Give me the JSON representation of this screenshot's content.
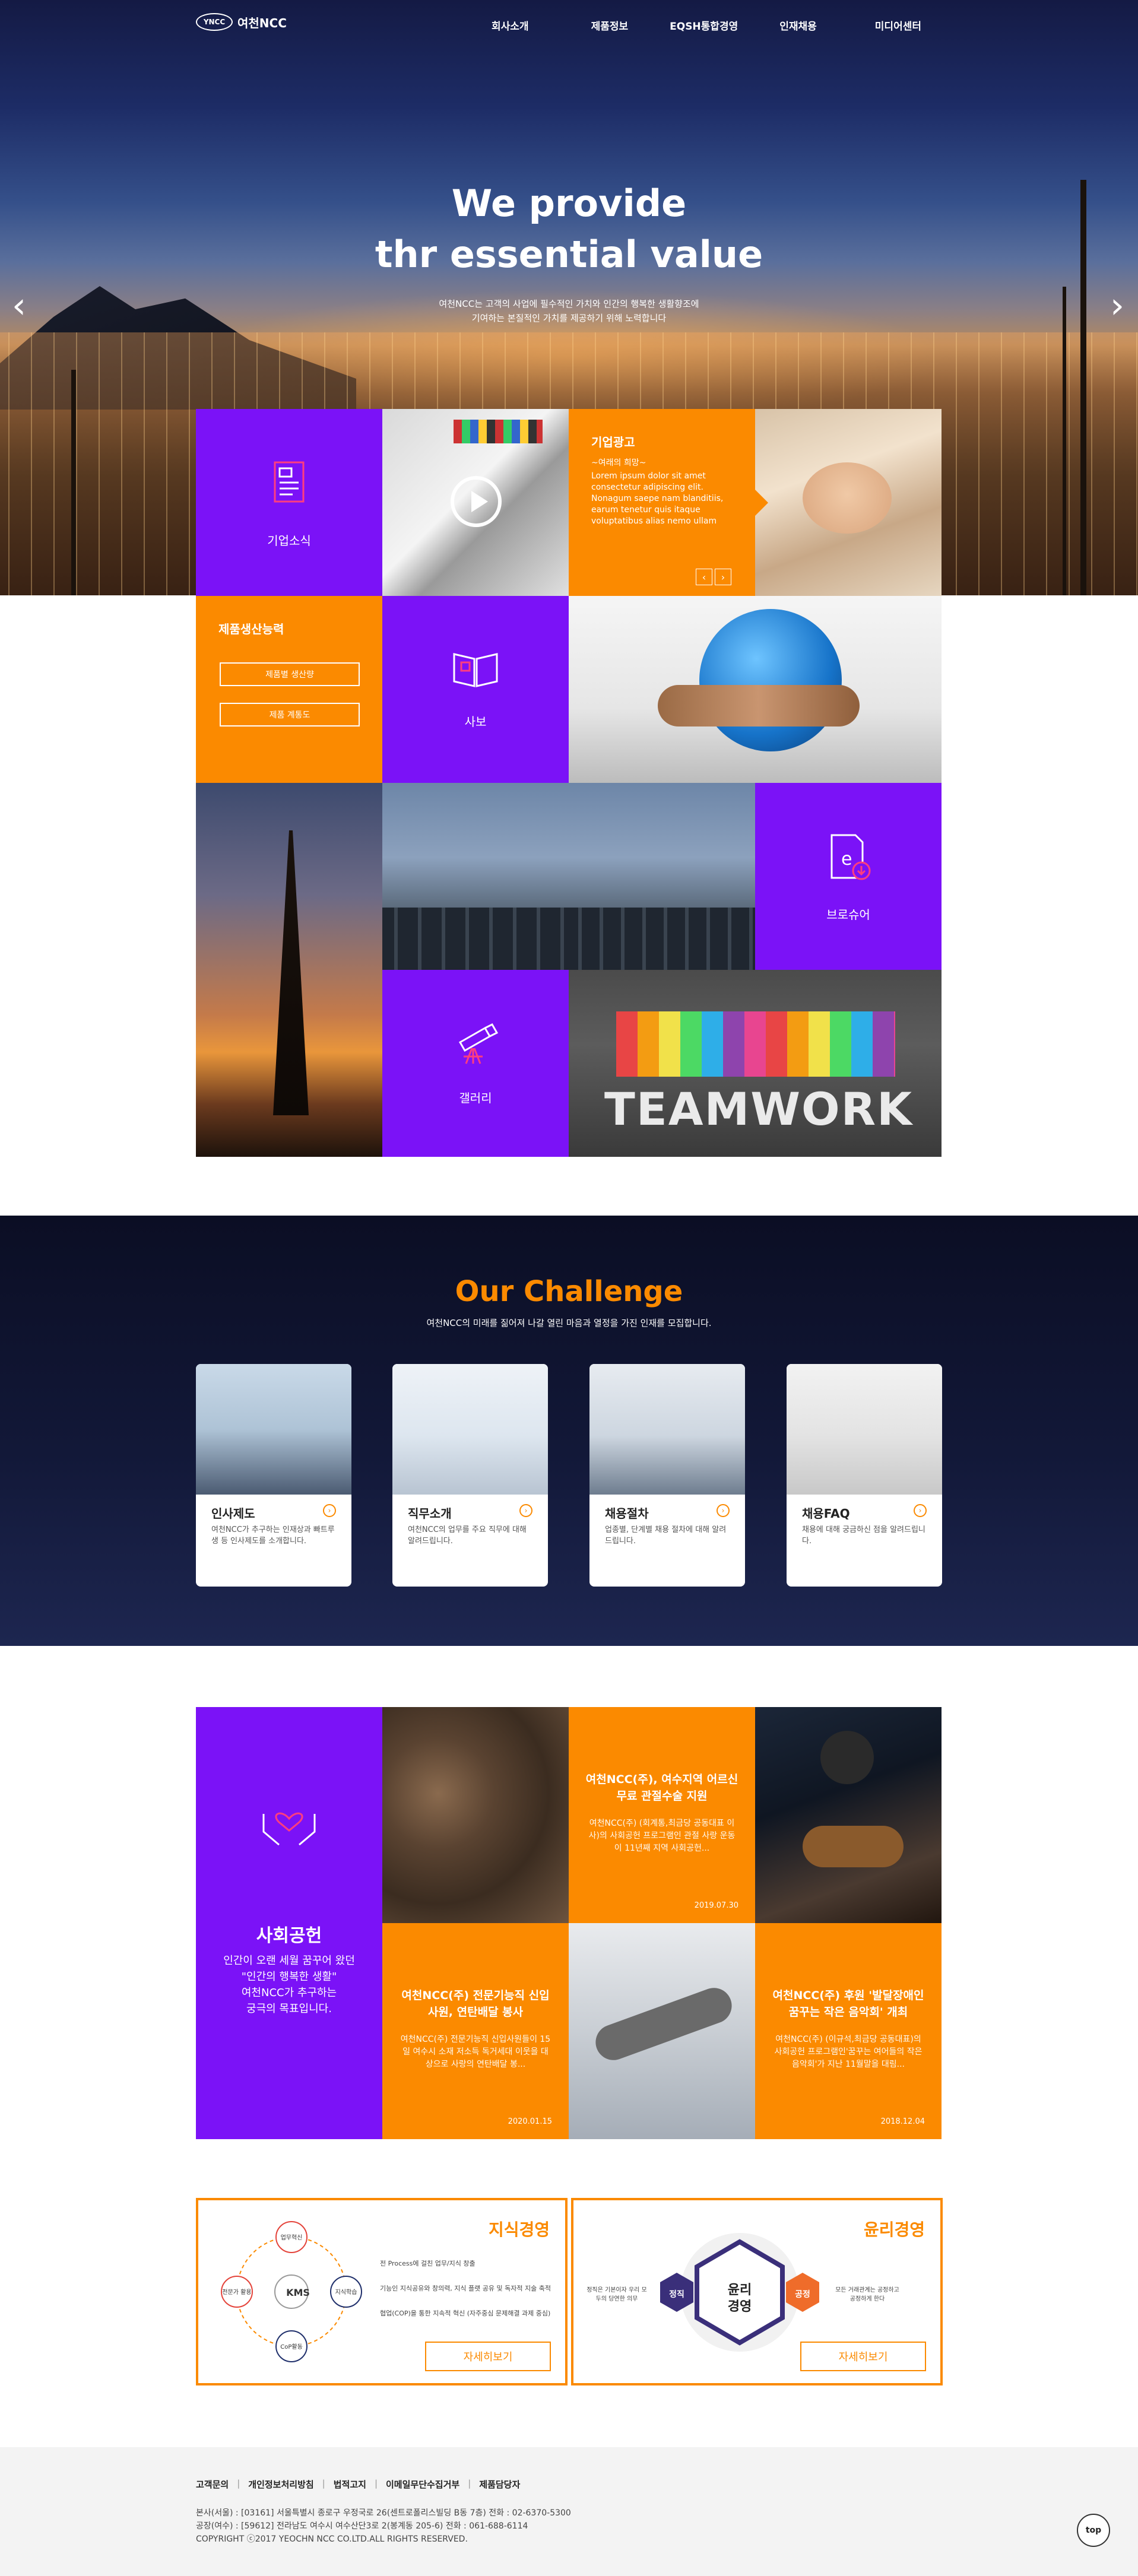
{
  "header": {
    "logo_mark": "YNCC",
    "logo_text": "여천NCC",
    "menu": [
      "회사소개",
      "제품정보",
      "EQSH통합경영",
      "인재채용",
      "미디어센터"
    ]
  },
  "hero": {
    "title_line1": "We provide",
    "title_line2": "thr essential value",
    "subtitle_line1": "여천NCC는 고객의 사업에 필수적인 가치와 인간의 행복한 생활향조에",
    "subtitle_line2": "기여하는 본질적인 가치를 제공하기 위해 노력합니다"
  },
  "tiles": {
    "company_intro": "기업소식",
    "ad_title": "기업광고",
    "ad_sub": "~여래의 희망~",
    "ad_body": "Lorem ipsum dolor sit amet consectetur adipiscing elit. Nonagum saepe nam blanditiis, earum tenetur quis itaque voluptatibus alias nemo ullam",
    "capacity_title": "제품생산능력",
    "capacity_btn1": "제품별 생산량",
    "capacity_btn2": "제품 계통도",
    "newsletter": "사보",
    "brochure": "브로슈어",
    "gallery": "갤러리",
    "teamwork_word": "TEAMWORK"
  },
  "challenge": {
    "title": "Our Challenge",
    "subtitle": "여천NCC의 미래를 짊어져 나갈 열린 마음과 열정을 가진 인재를 모집합니다.",
    "cards": [
      {
        "title": "인사제도",
        "desc": "여천NCC가 추구하는 인재상과 빠트루생 등 인사제도를 소개합니다."
      },
      {
        "title": "직무소개",
        "desc": "여천NCC의 업무를 주요 직무에 대해 알려드립니다."
      },
      {
        "title": "채용절차",
        "desc": "업종별, 단계별 채용 절차에 대해 알려드립니다."
      },
      {
        "title": "채용FAQ",
        "desc": "채용에 대해 궁금하신 점을 알려드립니다."
      }
    ]
  },
  "social": {
    "title": "사회공헌",
    "desc_line1": "인간이 오랜 세월 꿈꾸어 왔던",
    "desc_line2": "\"인간의 행복한 생활\"",
    "desc_line3": "여천NCC가 추구하는",
    "desc_line4": "궁극의 목표입니다.",
    "news": [
      {
        "title": "여천NCC(주), 여수지역 어르신 무료 관절수술 지원",
        "body": "여천NCC(주) (회계통,최금당 공동대표 이사)의 사회공헌 프로그램인 관절 사랑 운동이 11년째 지역 사회공헌...",
        "date": "2019.07.30"
      },
      {
        "title": "여천NCC(주) 전문기능직 신입사원, 연탄배달 봉사",
        "body": "여천NCC(주) 전문기능직 신입사원들이 15일 여수시 소재 저소득 독거세대 이웃을 대상으로 사랑의 연탄배달 봉...",
        "date": "2020.01.15"
      },
      {
        "title": "여천NCC(주) 후원 '발달장애인 꿈꾸는 작은 음악회' 개최",
        "body": "여천NCC(주) (이규석,최금당 공동대표)의 사회공헌 프로그램인'꿈꾸는 여어들의 작은 음악회'가 지난 11월말을 대림...",
        "date": "2018.12.04"
      }
    ]
  },
  "kms": {
    "title": "지식경영",
    "center": "KMS",
    "nodes": [
      "업무혁신",
      "지식학습",
      "CoP활동",
      "전문가 활용"
    ],
    "lines": [
      "전 Process에 걸친 업무/지식 창출",
      "기능인 지식공유와 창의력, 지식 플랫 공유 및 독자적 지술 축적",
      "협업(COP)을 통한 지속적 혁신 (자주중심 문제해결 과제 중심)"
    ],
    "button": "자세히보기"
  },
  "ethics": {
    "title": "윤리경영",
    "center_line1": "윤리",
    "center_line2": "경영",
    "left_label": "정직",
    "right_label": "공정",
    "left_text": "정직은 기본이자 우리 모두의 당연한 의무",
    "right_text": "모든 거래관계는 공정하고 공정하게 한다",
    "button": "자세히보기"
  },
  "footer": {
    "links": [
      "고객문의",
      "개인정보처리방침",
      "법적고지",
      "이메일무단수집거부",
      "제품담당자"
    ],
    "addr1": "본사(서울) : [03161] 서울특별시 종로구 우정국로 26(센트로폴리스빌딩 B동 7층) 전화 : 02-6370-5300",
    "addr2": "공장(여수) : [59612] 전라남도 여수시 여수산단3로 2(봉계동 205-6) 전화 : 061-688-6114",
    "copyright": "COPYRIGHT ⓒ2017 YEOCHN NCC CO.LTD.ALL RIGHTS RESERVED.",
    "top": "top"
  },
  "colors": {
    "purple": "#7b12f7",
    "orange": "#fb8a00",
    "navy": "#0b0e24"
  }
}
